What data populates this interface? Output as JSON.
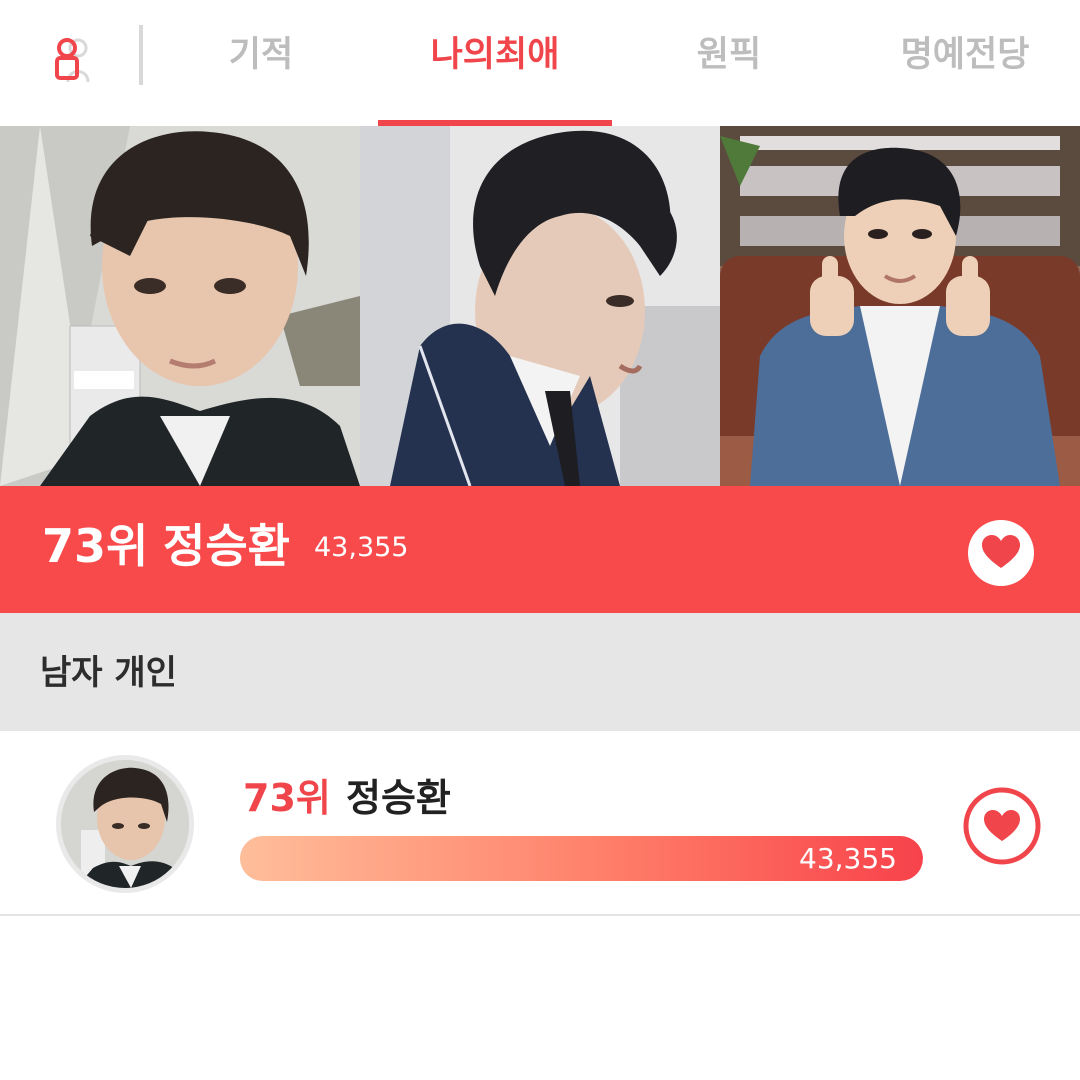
{
  "nav": {
    "logo_icon": "person-avatar-icon",
    "tabs": [
      {
        "label": "기적",
        "active": false
      },
      {
        "label": "나의최애",
        "active": true
      },
      {
        "label": "원픽",
        "active": false
      },
      {
        "label": "명예전당",
        "active": false
      }
    ]
  },
  "photos": [
    {
      "icon": "profile-photo-selfie"
    },
    {
      "icon": "profile-photo-side"
    },
    {
      "icon": "profile-photo-thumbs-up"
    }
  ],
  "banner": {
    "rank": "73위",
    "name": "정승환",
    "votes": "43,355",
    "heart_icon": "heart-icon"
  },
  "category": {
    "title": "남자 개인"
  },
  "list": {
    "items": [
      {
        "rank": "73위",
        "name": "정승환",
        "votes": "43,355",
        "progress_percent": 100,
        "heart_icon": "heart-icon"
      }
    ]
  },
  "colors": {
    "accent": "#f0454a",
    "banner": "#f84a4b",
    "inactive_tab": "#bdbdbd",
    "category_bg": "#e6e6e6"
  }
}
